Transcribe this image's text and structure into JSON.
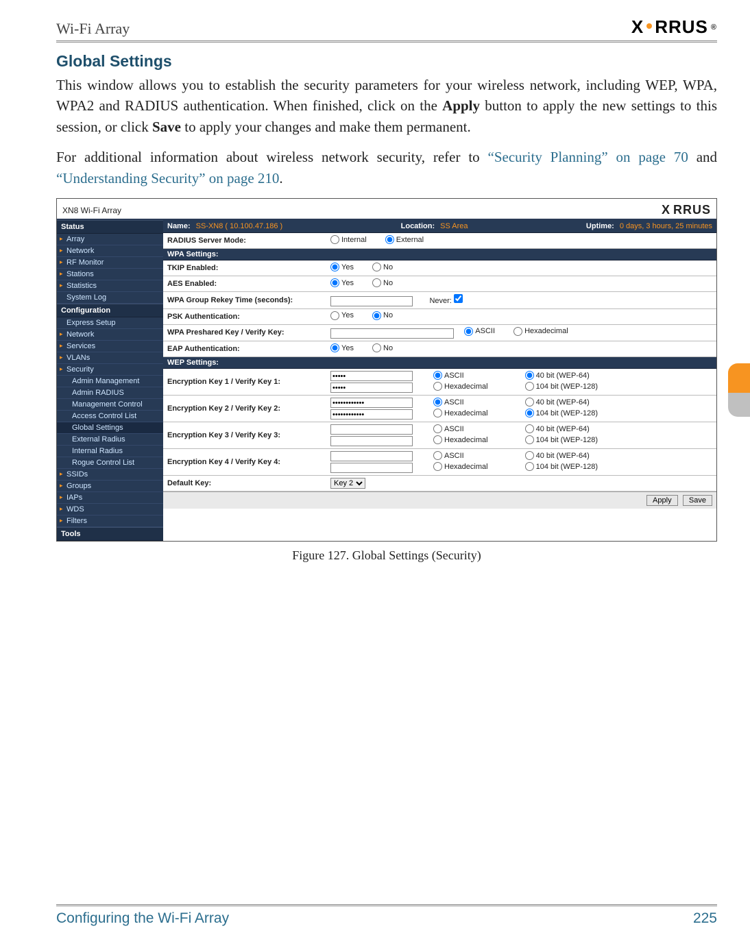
{
  "doc_header": {
    "left": "Wi-Fi Array",
    "logo": "XIRRUS"
  },
  "section_title": "Global Settings",
  "para1_a": "This window allows you to establish the security parameters for your wireless network, including WEP, WPA, WPA2 and RADIUS authentication. When finished, click on the ",
  "para1_b": "Apply",
  "para1_c": " button to apply the new settings to this session, or click ",
  "para1_d": "Save",
  "para1_e": " to apply your changes and make them permanent.",
  "para2_a": "For additional information about wireless network security, refer to ",
  "para2_link1": "“Security Planning” on page 70",
  "para2_b": " and ",
  "para2_link2": "“Understanding Security” on page 210",
  "para2_c": ".",
  "fig_caption": "Figure 127. Global Settings (Security)",
  "footer": {
    "left": "Configuring the Wi-Fi Array",
    "page": "225"
  },
  "shot": {
    "title": "XN8 Wi-Fi Array",
    "logo": "XIRRUS",
    "nav": {
      "status": "Status",
      "status_items": [
        "Array",
        "Network",
        "RF Monitor",
        "Stations",
        "Statistics",
        "System Log"
      ],
      "config": "Configuration",
      "config_items": [
        "Express Setup",
        "Network",
        "Services",
        "VLANs"
      ],
      "security": "Security",
      "security_items": [
        "Admin Management",
        "Admin RADIUS",
        "Management Control",
        "Access Control List",
        "Global Settings",
        "External Radius",
        "Internal Radius",
        "Rogue Control List"
      ],
      "security_selected": "Global Settings",
      "after_items": [
        "SSIDs",
        "Groups",
        "IAPs",
        "WDS",
        "Filters"
      ],
      "tools": "Tools"
    },
    "bar": {
      "name_l": "Name:",
      "name_v": "SS-XN8   ( 10.100.47.186 )",
      "loc_l": "Location:",
      "loc_v": "SS Area",
      "up_l": "Uptime:",
      "up_v": "0 days, 3 hours, 25 minutes"
    },
    "rows": {
      "radius": {
        "label": "RADIUS Server Mode:",
        "opt1": "Internal",
        "opt2": "External",
        "sel": "External"
      },
      "wpa_hdr": "WPA Settings:",
      "tkip": {
        "label": "TKIP Enabled:",
        "yes": "Yes",
        "no": "No",
        "sel": "Yes"
      },
      "aes": {
        "label": "AES Enabled:",
        "yes": "Yes",
        "no": "No",
        "sel": "Yes"
      },
      "rekey": {
        "label": "WPA Group Rekey Time (seconds):",
        "never": "Never:"
      },
      "psk": {
        "label": "PSK Authentication:",
        "yes": "Yes",
        "no": "No",
        "sel": "No"
      },
      "preshared": {
        "label": "WPA Preshared Key / Verify Key:",
        "ascii": "ASCII",
        "hex": "Hexadecimal",
        "sel": "ASCII"
      },
      "eap": {
        "label": "EAP Authentication:",
        "yes": "Yes",
        "no": "No",
        "sel": "Yes"
      },
      "wep_hdr": "WEP Settings:",
      "k1": {
        "label": "Encryption Key 1 / Verify Key 1:",
        "v1": "•••••",
        "v2": "•••••",
        "a": "ASCII",
        "h": "Hexadecimal",
        "b40": "40 bit (WEP-64)",
        "b104": "104 bit (WEP-128)",
        "asel": "ASCII",
        "bsel": "40"
      },
      "k2": {
        "label": "Encryption Key 2 / Verify Key 2:",
        "v1": "••••••••••••",
        "v2": "••••••••••••",
        "a": "ASCII",
        "h": "Hexadecimal",
        "b40": "40 bit (WEP-64)",
        "b104": "104 bit (WEP-128)",
        "asel": "ASCII",
        "bsel": "104"
      },
      "k3": {
        "label": "Encryption Key 3 / Verify Key 3:",
        "a": "ASCII",
        "h": "Hexadecimal",
        "b40": "40 bit (WEP-64)",
        "b104": "104 bit (WEP-128)"
      },
      "k4": {
        "label": "Encryption Key 4 / Verify Key 4:",
        "a": "ASCII",
        "h": "Hexadecimal",
        "b40": "40 bit (WEP-64)",
        "b104": "104 bit (WEP-128)"
      },
      "defkey": {
        "label": "Default Key:",
        "val": "Key 2"
      },
      "apply": "Apply",
      "save": "Save"
    }
  }
}
